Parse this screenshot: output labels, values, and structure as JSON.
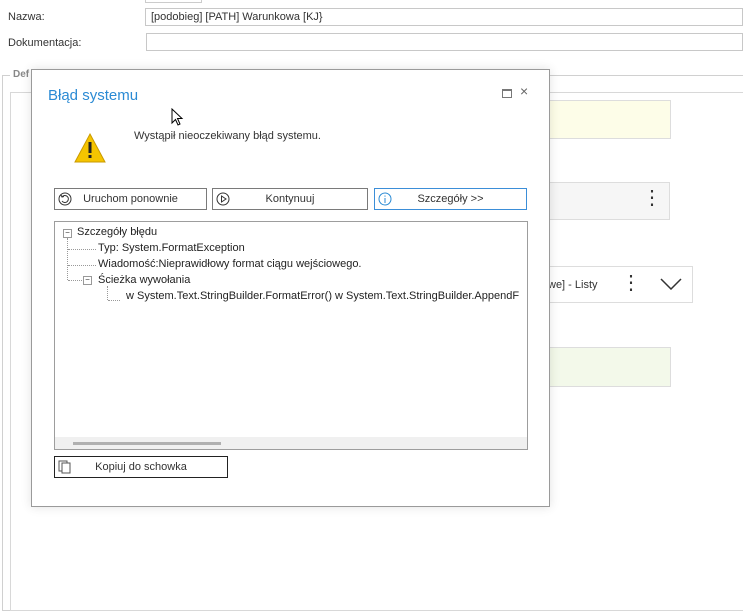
{
  "form": {
    "nazwa_label": "Nazwa:",
    "nazwa_value": "[podobieg] [PATH] Warunkowa [KJ}",
    "dokumentacja_label": "Dokumentacja:",
    "dokumentacja_value": "",
    "section_legend": "Def",
    "right_text": "we] - Listy"
  },
  "dialog": {
    "title": "Błąd systemu",
    "message": "Wystąpił nieoczekiwany błąd systemu.",
    "buttons": {
      "restart": "Uruchom ponownie",
      "continue": "Kontynuuj",
      "details": "Szczegóły >>",
      "copy": "Kopiuj do schowka"
    },
    "tree": {
      "root": "Szczegóły błędu",
      "type": "Typ: System.FormatException",
      "message": "Wiadomość:Nieprawidłowy format ciągu wejściowego.",
      "stack_label": "Ścieżka wywołania",
      "stack_value": "w System.Text.StringBuilder.FormatError()   w System.Text.StringBuilder.AppendF"
    }
  },
  "colors": {
    "accent": "#2a8ad4",
    "warning": "#f5c400",
    "yellow_box": "#fdfde8",
    "green_box": "#f3f9ea"
  }
}
